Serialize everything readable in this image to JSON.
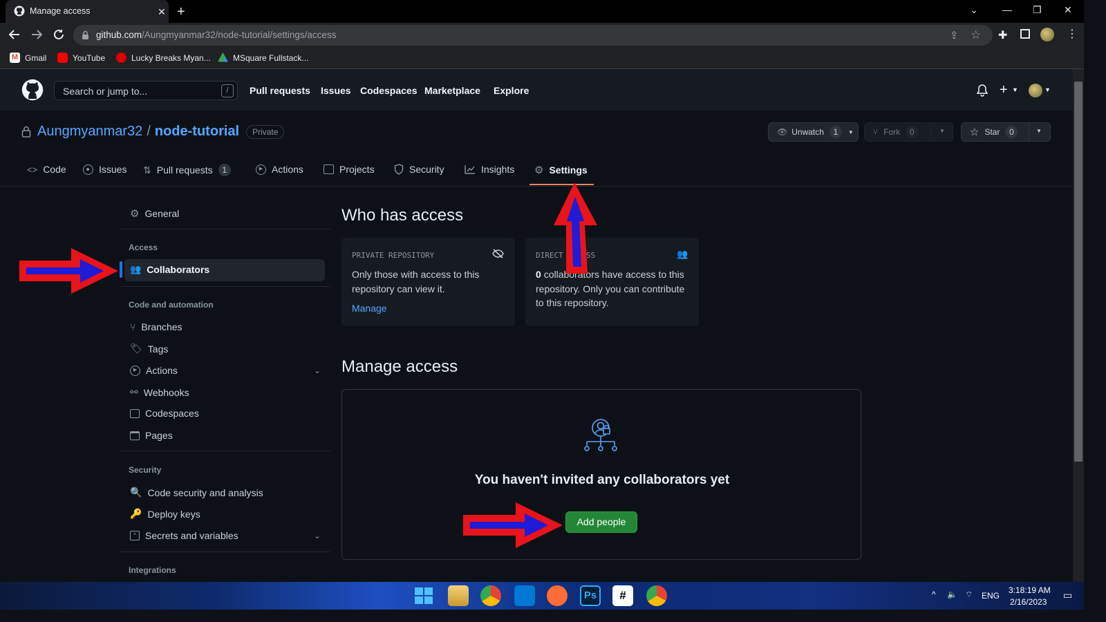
{
  "browser": {
    "tab_title": "Manage access",
    "url_host": "github.com",
    "url_path": "/Aungmyanmar32/node-tutorial/settings/access",
    "bookmarks": [
      "Gmail",
      "YouTube",
      "Lucky Breaks Myan...",
      "MSquare Fullstack..."
    ]
  },
  "github_header": {
    "search_placeholder": "Search or jump to...",
    "search_shortcut": "/",
    "nav": [
      "Pull requests",
      "Issues",
      "Codespaces",
      "Marketplace",
      "Explore"
    ]
  },
  "repo": {
    "owner": "Aungmyanmar32",
    "separator": "/",
    "name": "node-tutorial",
    "visibility": "Private",
    "unwatch_label": "Unwatch",
    "unwatch_count": "1",
    "fork_label": "Fork",
    "fork_count": "0",
    "star_label": "Star",
    "star_count": "0"
  },
  "repo_tabs": [
    {
      "label": "Code"
    },
    {
      "label": "Issues"
    },
    {
      "label": "Pull requests",
      "count": "1"
    },
    {
      "label": "Actions"
    },
    {
      "label": "Projects"
    },
    {
      "label": "Security"
    },
    {
      "label": "Insights"
    },
    {
      "label": "Settings"
    }
  ],
  "sidebar": {
    "general": "General",
    "access_heading": "Access",
    "collaborators": "Collaborators",
    "code_heading": "Code and automation",
    "branches": "Branches",
    "tags": "Tags",
    "actions": "Actions",
    "webhooks": "Webhooks",
    "codespaces": "Codespaces",
    "pages": "Pages",
    "security_heading": "Security",
    "code_security": "Code security and analysis",
    "deploy_keys": "Deploy keys",
    "secrets": "Secrets and variables",
    "integrations_heading": "Integrations"
  },
  "main": {
    "who_title": "Who has access",
    "private_card": {
      "title": "PRIVATE REPOSITORY",
      "text": "Only those with access to this repository can view it.",
      "link": "Manage"
    },
    "direct_card": {
      "title": "DIRECT ACCESS",
      "count": "0",
      "text": "collaborators have access to this repository. Only you can contribute to this repository."
    },
    "manage_title": "Manage access",
    "empty_title": "You haven't invited any collaborators yet",
    "add_button": "Add people"
  },
  "taskbar": {
    "language": "ENG",
    "time": "3:18:19 AM",
    "date": "2/16/2023"
  },
  "colors": {
    "annotation_red": "#e8131b",
    "annotation_blue": "#1f1bd6",
    "accent_green": "#238636",
    "link_blue": "#58a6ff"
  }
}
